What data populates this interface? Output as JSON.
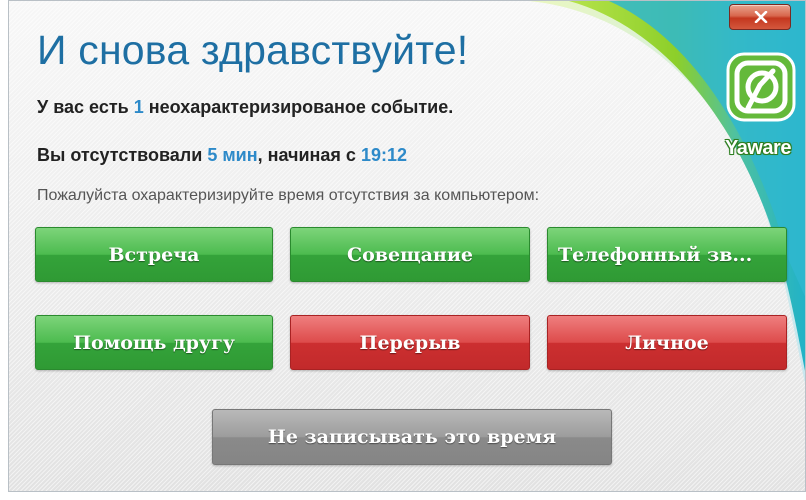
{
  "window": {
    "close_symbol": "x",
    "accent_colors": {
      "title": "#1e6fa3",
      "highlight": "#2d8ac9",
      "swoosh_green": "#8dcf2a",
      "swoosh_teal": "#20b2c8"
    }
  },
  "header": {
    "title": "И снова здравствуйте!"
  },
  "logo": {
    "icon": "yaware-logo-icon",
    "text": "Yaware"
  },
  "info": {
    "events_prefix": "У вас есть",
    "events_count": "1",
    "events_suffix": "неохарактеризированое событие.",
    "absent_prefix": "Вы отсутствовали",
    "absent_duration": "5 мин",
    "absent_middle": ", начиная с",
    "absent_start": "19:12",
    "prompt": "Пожалуйста охарактеризируйте время отсутствия за компьютером:"
  },
  "buttons": {
    "meeting": "Встреча",
    "conference": "Совещание",
    "phone_call": "Телефонный зв...",
    "help_friend": "Помощь другу",
    "break": "Перерыв",
    "personal": "Личное",
    "dont_record": "Не записывать это время"
  }
}
